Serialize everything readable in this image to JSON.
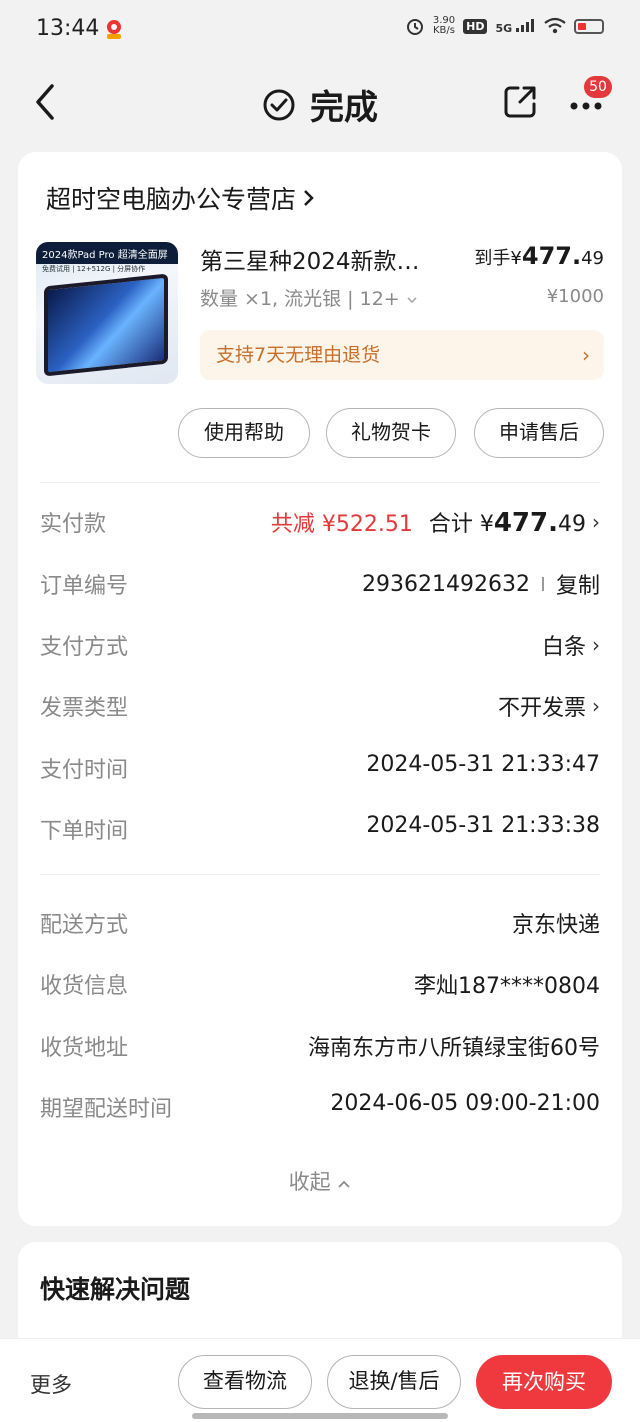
{
  "status_bar": {
    "time": "13:44",
    "net_speed_value": "3.90",
    "net_speed_unit": "KB/s",
    "hd": "HD",
    "signal": "5G"
  },
  "nav": {
    "title": "完成",
    "badge": "50"
  },
  "shop": {
    "name": "超时空电脑办公专营店"
  },
  "product": {
    "image_tag": "2024款Pad Pro 超清全面屏",
    "image_subtag": "免费试用 | 12+512G | 分屏协作",
    "title": "第三星种2024新款…",
    "price_prefix": "到手¥",
    "price_int": "477.",
    "price_dec": "49",
    "spec": "数量 ×1, 流光银 | 12+",
    "original_price": "¥1000",
    "return_policy": "支持7天无理由退货"
  },
  "actions": {
    "help": "使用帮助",
    "gift_card": "礼物贺卡",
    "after_sales": "申请售后"
  },
  "order": {
    "paid_label": "实付款",
    "discount": "共减 ¥522.51",
    "total_label": "合计 ¥",
    "total_int": "477.",
    "total_dec": "49",
    "order_no_label": "订单编号",
    "order_no": "293621492632",
    "copy": "复制",
    "pay_method_label": "支付方式",
    "pay_method": "白条",
    "invoice_label": "发票类型",
    "invoice": "不开发票",
    "pay_time_label": "支付时间",
    "pay_time": "2024-05-31 21:33:47",
    "order_time_label": "下单时间",
    "order_time": "2024-05-31 21:33:38",
    "delivery_label": "配送方式",
    "delivery": "京东快递",
    "receiver_label": "收货信息",
    "receiver": "李灿187****0804",
    "address_label": "收货地址",
    "address": "海南东方市八所镇绿宝街60号",
    "expected_label": "期望配送时间",
    "expected": "2024-06-05 09:00-21:00",
    "collapse": "收起"
  },
  "quick_solve": {
    "title": "快速解决问题"
  },
  "bottom": {
    "more": "更多",
    "logistics": "查看物流",
    "return": "退换/售后",
    "rebuy": "再次购买"
  },
  "colors": {
    "accent": "#e4393c",
    "return_bg": "#fdf4ea",
    "return_text": "#c8702a"
  }
}
